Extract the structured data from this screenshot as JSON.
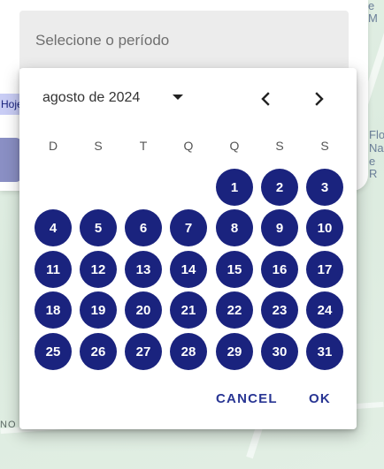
{
  "background": {
    "period_placeholder": "Selecione o período",
    "today_chip": "Hoje",
    "map_labels": {
      "top_right": "e M",
      "right_1": "Flo",
      "right_2": "Nac",
      "right_3": "e R",
      "bottom_left": "NO"
    }
  },
  "picker": {
    "month_label": "agosto de 2024",
    "weekdays": [
      "D",
      "S",
      "T",
      "Q",
      "Q",
      "S",
      "S"
    ],
    "days": [
      "1",
      "2",
      "3",
      "4",
      "5",
      "6",
      "7",
      "8",
      "9",
      "10",
      "11",
      "12",
      "13",
      "14",
      "15",
      "16",
      "17",
      "18",
      "19",
      "20",
      "21",
      "22",
      "23",
      "24",
      "25",
      "26",
      "27",
      "28",
      "29",
      "30",
      "31"
    ],
    "first_weekday_index": 4,
    "cancel_label": "CANCEL",
    "ok_label": "OK",
    "icons": {
      "dropdown": "arrow-drop-down-icon",
      "prev": "chevron-left-icon",
      "next": "chevron-right-icon"
    }
  },
  "colors": {
    "primary": "#1a237e",
    "action_text": "#283593"
  }
}
